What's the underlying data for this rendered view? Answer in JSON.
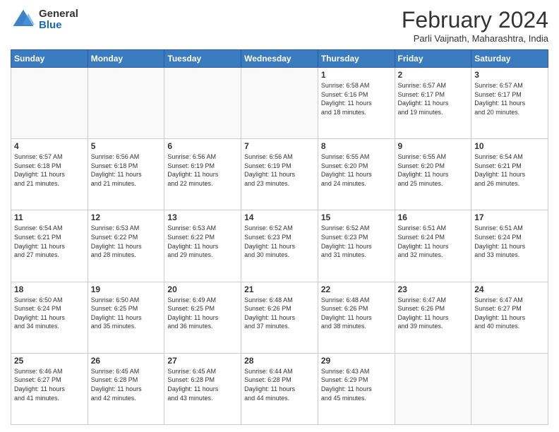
{
  "header": {
    "logo_general": "General",
    "logo_blue": "Blue",
    "title": "February 2024",
    "location": "Parli Vaijnath, Maharashtra, India"
  },
  "days_of_week": [
    "Sunday",
    "Monday",
    "Tuesday",
    "Wednesday",
    "Thursday",
    "Friday",
    "Saturday"
  ],
  "weeks": [
    [
      {
        "day": "",
        "info": ""
      },
      {
        "day": "",
        "info": ""
      },
      {
        "day": "",
        "info": ""
      },
      {
        "day": "",
        "info": ""
      },
      {
        "day": "1",
        "info": "Sunrise: 6:58 AM\nSunset: 6:16 PM\nDaylight: 11 hours\nand 18 minutes."
      },
      {
        "day": "2",
        "info": "Sunrise: 6:57 AM\nSunset: 6:17 PM\nDaylight: 11 hours\nand 19 minutes."
      },
      {
        "day": "3",
        "info": "Sunrise: 6:57 AM\nSunset: 6:17 PM\nDaylight: 11 hours\nand 20 minutes."
      }
    ],
    [
      {
        "day": "4",
        "info": "Sunrise: 6:57 AM\nSunset: 6:18 PM\nDaylight: 11 hours\nand 21 minutes."
      },
      {
        "day": "5",
        "info": "Sunrise: 6:56 AM\nSunset: 6:18 PM\nDaylight: 11 hours\nand 21 minutes."
      },
      {
        "day": "6",
        "info": "Sunrise: 6:56 AM\nSunset: 6:19 PM\nDaylight: 11 hours\nand 22 minutes."
      },
      {
        "day": "7",
        "info": "Sunrise: 6:56 AM\nSunset: 6:19 PM\nDaylight: 11 hours\nand 23 minutes."
      },
      {
        "day": "8",
        "info": "Sunrise: 6:55 AM\nSunset: 6:20 PM\nDaylight: 11 hours\nand 24 minutes."
      },
      {
        "day": "9",
        "info": "Sunrise: 6:55 AM\nSunset: 6:20 PM\nDaylight: 11 hours\nand 25 minutes."
      },
      {
        "day": "10",
        "info": "Sunrise: 6:54 AM\nSunset: 6:21 PM\nDaylight: 11 hours\nand 26 minutes."
      }
    ],
    [
      {
        "day": "11",
        "info": "Sunrise: 6:54 AM\nSunset: 6:21 PM\nDaylight: 11 hours\nand 27 minutes."
      },
      {
        "day": "12",
        "info": "Sunrise: 6:53 AM\nSunset: 6:22 PM\nDaylight: 11 hours\nand 28 minutes."
      },
      {
        "day": "13",
        "info": "Sunrise: 6:53 AM\nSunset: 6:22 PM\nDaylight: 11 hours\nand 29 minutes."
      },
      {
        "day": "14",
        "info": "Sunrise: 6:52 AM\nSunset: 6:23 PM\nDaylight: 11 hours\nand 30 minutes."
      },
      {
        "day": "15",
        "info": "Sunrise: 6:52 AM\nSunset: 6:23 PM\nDaylight: 11 hours\nand 31 minutes."
      },
      {
        "day": "16",
        "info": "Sunrise: 6:51 AM\nSunset: 6:24 PM\nDaylight: 11 hours\nand 32 minutes."
      },
      {
        "day": "17",
        "info": "Sunrise: 6:51 AM\nSunset: 6:24 PM\nDaylight: 11 hours\nand 33 minutes."
      }
    ],
    [
      {
        "day": "18",
        "info": "Sunrise: 6:50 AM\nSunset: 6:24 PM\nDaylight: 11 hours\nand 34 minutes."
      },
      {
        "day": "19",
        "info": "Sunrise: 6:50 AM\nSunset: 6:25 PM\nDaylight: 11 hours\nand 35 minutes."
      },
      {
        "day": "20",
        "info": "Sunrise: 6:49 AM\nSunset: 6:25 PM\nDaylight: 11 hours\nand 36 minutes."
      },
      {
        "day": "21",
        "info": "Sunrise: 6:48 AM\nSunset: 6:26 PM\nDaylight: 11 hours\nand 37 minutes."
      },
      {
        "day": "22",
        "info": "Sunrise: 6:48 AM\nSunset: 6:26 PM\nDaylight: 11 hours\nand 38 minutes."
      },
      {
        "day": "23",
        "info": "Sunrise: 6:47 AM\nSunset: 6:26 PM\nDaylight: 11 hours\nand 39 minutes."
      },
      {
        "day": "24",
        "info": "Sunrise: 6:47 AM\nSunset: 6:27 PM\nDaylight: 11 hours\nand 40 minutes."
      }
    ],
    [
      {
        "day": "25",
        "info": "Sunrise: 6:46 AM\nSunset: 6:27 PM\nDaylight: 11 hours\nand 41 minutes."
      },
      {
        "day": "26",
        "info": "Sunrise: 6:45 AM\nSunset: 6:28 PM\nDaylight: 11 hours\nand 42 minutes."
      },
      {
        "day": "27",
        "info": "Sunrise: 6:45 AM\nSunset: 6:28 PM\nDaylight: 11 hours\nand 43 minutes."
      },
      {
        "day": "28",
        "info": "Sunrise: 6:44 AM\nSunset: 6:28 PM\nDaylight: 11 hours\nand 44 minutes."
      },
      {
        "day": "29",
        "info": "Sunrise: 6:43 AM\nSunset: 6:29 PM\nDaylight: 11 hours\nand 45 minutes."
      },
      {
        "day": "",
        "info": ""
      },
      {
        "day": "",
        "info": ""
      }
    ]
  ]
}
